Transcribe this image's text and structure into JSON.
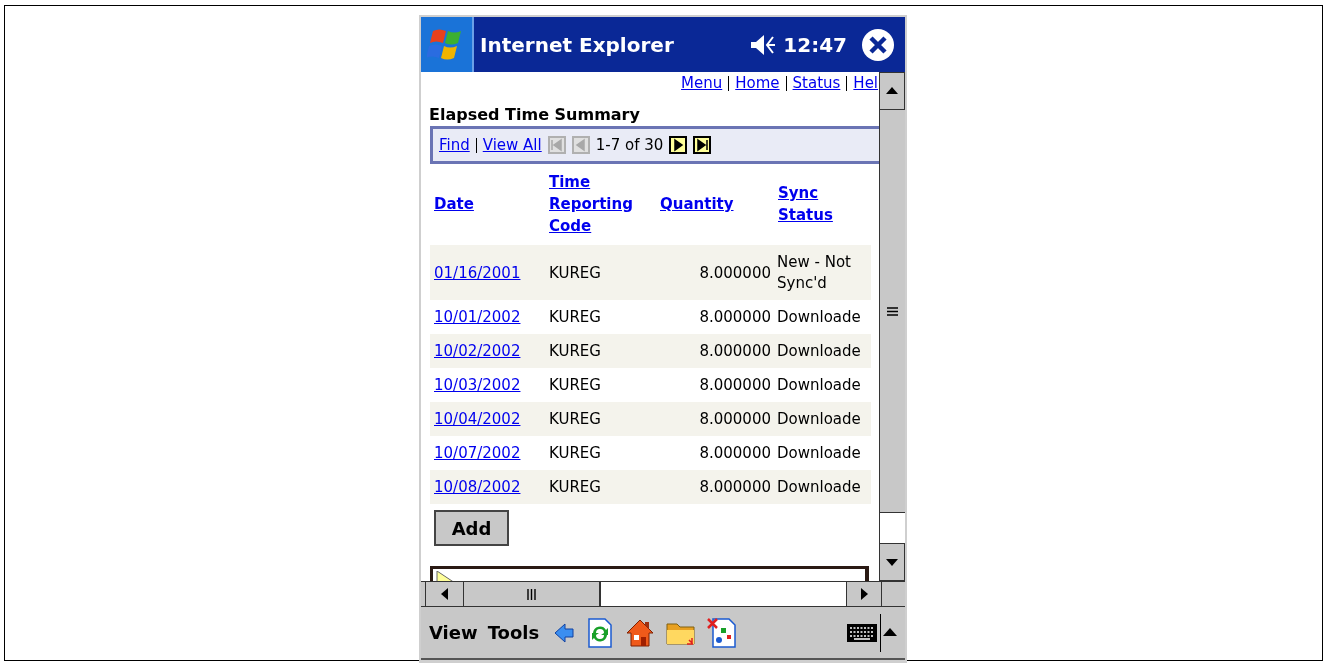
{
  "window": {
    "title": "Internet Explorer",
    "time": "12:47"
  },
  "nav_links": [
    "Menu",
    "Home",
    "Status",
    "Hel"
  ],
  "heading": "Elapsed Time Summary",
  "pager": {
    "links": [
      "Find",
      "View All"
    ],
    "range": "1-7 of 30",
    "buttons": [
      {
        "kind": "first",
        "disabled": true
      },
      {
        "kind": "prev",
        "disabled": true
      },
      {
        "kind": "next",
        "disabled": false
      },
      {
        "kind": "last",
        "disabled": false
      }
    ]
  },
  "table": {
    "columns": [
      "Date",
      "Time Reporting Code",
      "Quantity",
      "Sync Status"
    ],
    "rows": [
      {
        "date": "01/16/2001",
        "code": "KUREG",
        "quantity": "8.000000",
        "status": "New - Not Sync'd"
      },
      {
        "date": "10/01/2002",
        "code": "KUREG",
        "quantity": "8.000000",
        "status": "Downloade"
      },
      {
        "date": "10/02/2002",
        "code": "KUREG",
        "quantity": "8.000000",
        "status": "Downloade"
      },
      {
        "date": "10/03/2002",
        "code": "KUREG",
        "quantity": "8.000000",
        "status": "Downloade"
      },
      {
        "date": "10/04/2002",
        "code": "KUREG",
        "quantity": "8.000000",
        "status": "Downloade"
      },
      {
        "date": "10/07/2002",
        "code": "KUREG",
        "quantity": "8.000000",
        "status": "Downloade"
      },
      {
        "date": "10/08/2002",
        "code": "KUREG",
        "quantity": "8.000000",
        "status": "Downloade"
      }
    ]
  },
  "add_button": "Add",
  "toolbar": {
    "menus": [
      "View",
      "Tools"
    ]
  }
}
